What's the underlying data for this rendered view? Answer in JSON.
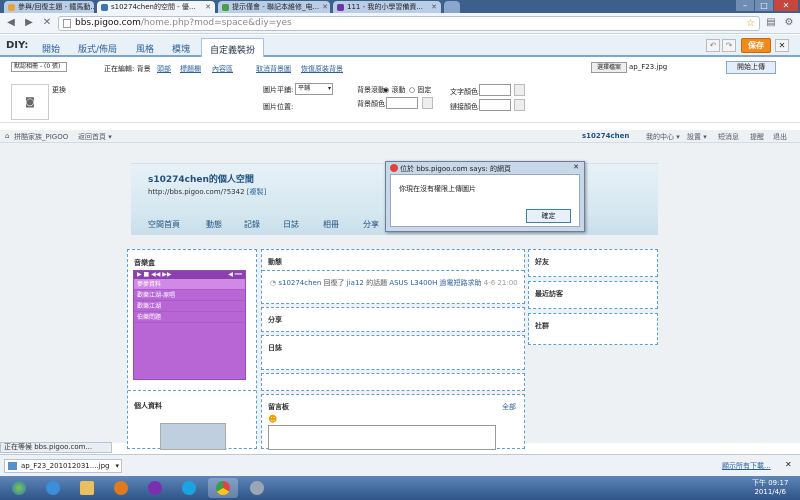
{
  "tabs": [
    {
      "label": "參與/回復主題 - 鐵馬動...",
      "color": "#e8a43a"
    },
    {
      "label": "s10274chen的空間 - 優...",
      "color": "#3b73b9"
    },
    {
      "label": "提示僅會 - 聯記本維修_电...",
      "color": "#4a9e4a"
    },
    {
      "label": "111 - 我的小學習備資...",
      "color": "#6a38a8"
    }
  ],
  "address": {
    "host": "bbs.pigoo.com",
    "path": "/home.php?mod=space&diy=yes"
  },
  "diy": {
    "title": "DIY:",
    "tabs": [
      "開始",
      "版式/佈局",
      "風格",
      "模塊",
      "自定義裝扮"
    ],
    "save_label": "保存",
    "undo": "↶",
    "redo": "↷",
    "close": "✕"
  },
  "tools": {
    "bg_select": "默認相冊 - (0 張)",
    "editing_label": "正在編輯: 背景",
    "links": [
      "頭部",
      "標題欄",
      "內容區"
    ],
    "cancel_bg": "取消背景圖",
    "restore_bg": "恢復原裝背景",
    "choose_file": "選擇檔案",
    "file_name": "ap_F23.jpg",
    "upload": "開始上傳"
  },
  "settings": {
    "change_label": "更換",
    "tile_label": "圖片平鋪:",
    "tile_value": "平鋪",
    "pos_label": "圖片位置:",
    "scroll_label": "背景滾動:",
    "scroll_opt1": "滾動",
    "scroll_opt2": "固定",
    "bgcolor_label": "背景顏色:",
    "textcolor_label": "文字顏色:",
    "linkcolor_label": "鏈接顏色:"
  },
  "sitebar": {
    "left": "拼酷家族_PIGOO",
    "left2": "返回首頁 ▾",
    "user": "s10274chen",
    "menu1": "我的中心 ▾",
    "menu2": "設置 ▾",
    "menu3": "短消息",
    "menu4": "提醒",
    "menu5": "退出"
  },
  "banner": {
    "title": "s10274chen的個人空間",
    "url": "http://bbs.pigoo.com/?5342",
    "copy": "[複製]",
    "nav": [
      "空間首頁",
      "動態",
      "記錄",
      "日誌",
      "相冊",
      "分享"
    ]
  },
  "music": {
    "title": "音樂盒",
    "ctrl": "▶ ■ ◀◀ ▶▶",
    "vol": "◀ ━━",
    "tracks": [
      "夢夢資料",
      "歡樂江湖-原唱",
      "歡樂江湖",
      "伯樂問題"
    ]
  },
  "profile": {
    "title": "個人資料"
  },
  "feed": {
    "title": "動態",
    "item_user": "s10274chen",
    "item_action": "回復了",
    "item_user2": "jia12",
    "item_text": "的話題",
    "item_topic": "ASUS L3400H 過電短路求助",
    "item_time": "4-6 21:00"
  },
  "share": {
    "title": "分享"
  },
  "blog": {
    "title": "日誌"
  },
  "guestbook": {
    "title": "留言板",
    "all": "全部"
  },
  "friends": {
    "title": "好友"
  },
  "visitors": {
    "title": "最近訪客"
  },
  "groups": {
    "title": "社群"
  },
  "dialog": {
    "title": "位於 bbs.pigoo.com says: 的網頁",
    "message": "你現在沒有權限上傳圖片",
    "ok": "確定"
  },
  "status": "正在等候 bbs.pigoo.com...",
  "download": {
    "file": "ap_F23_201012031....jpg",
    "show_all": "顯示所有下載..."
  },
  "clock": {
    "time": "下午 09:17",
    "date": "2011/4/6"
  }
}
